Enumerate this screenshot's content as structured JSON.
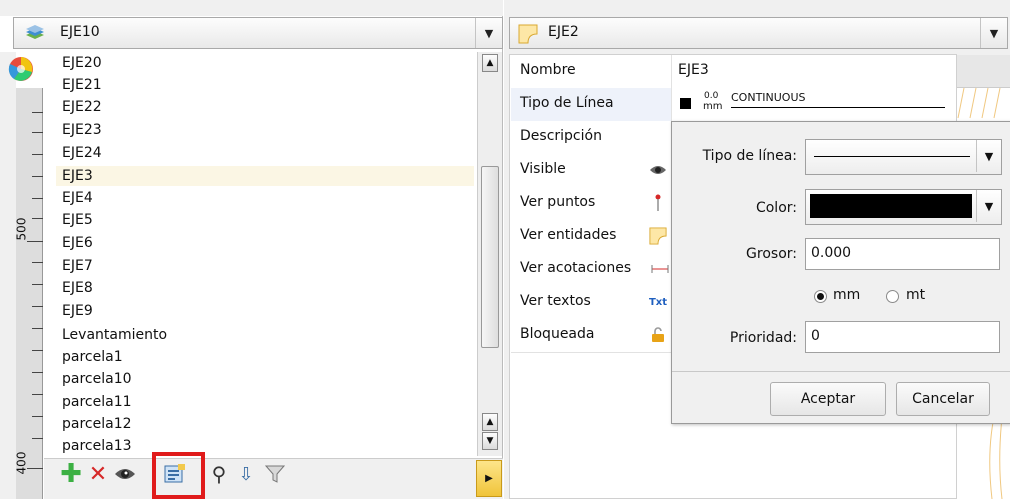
{
  "left_panel": {
    "layer_combo": {
      "value": "EJE10"
    },
    "layers": [
      "EJE20",
      "EJE21",
      "EJE22",
      "EJE23",
      "EJE24",
      "EJE3",
      "EJE4",
      "EJE5",
      "EJE6",
      "EJE7",
      "EJE8",
      "EJE9",
      "Levantamiento",
      "parcela1",
      "parcela10",
      "parcela11",
      "parcela12",
      "parcela13"
    ],
    "selected_index": 5,
    "ruler_labels": [
      "500",
      "400"
    ]
  },
  "right_panel": {
    "entity_combo": {
      "value": "EJE2"
    },
    "properties": {
      "nombre": {
        "label": "Nombre",
        "value": "EJE3"
      },
      "tipo_linea": {
        "label": "Tipo de Línea",
        "width": "0.0",
        "unit": "mm",
        "type": "CONTINUOUS"
      },
      "descripcion": {
        "label": "Descripción"
      },
      "visible": {
        "label": "Visible"
      },
      "ver_puntos": {
        "label": "Ver puntos"
      },
      "ver_entidades": {
        "label": "Ver entidades"
      },
      "ver_acotaciones": {
        "label": "Ver acotaciones"
      },
      "ver_textos": {
        "label": "Ver textos",
        "icon_text": "Txt"
      },
      "bloqueada": {
        "label": "Bloqueada"
      }
    }
  },
  "dialog": {
    "tipo_label": "Tipo de línea:",
    "color_label": "Color:",
    "color_value": "#000000",
    "grosor_label": "Grosor:",
    "grosor_value": "0.000",
    "unit_mm": "mm",
    "unit_mt": "mt",
    "prioridad_label": "Prioridad:",
    "prioridad_value": "0",
    "accept": "Aceptar",
    "cancel": "Cancelar"
  },
  "colors": {
    "highlight_box": "#e01b1b",
    "selected_row": "#fbf6e4",
    "accent_yellow": "#f2c94c"
  }
}
